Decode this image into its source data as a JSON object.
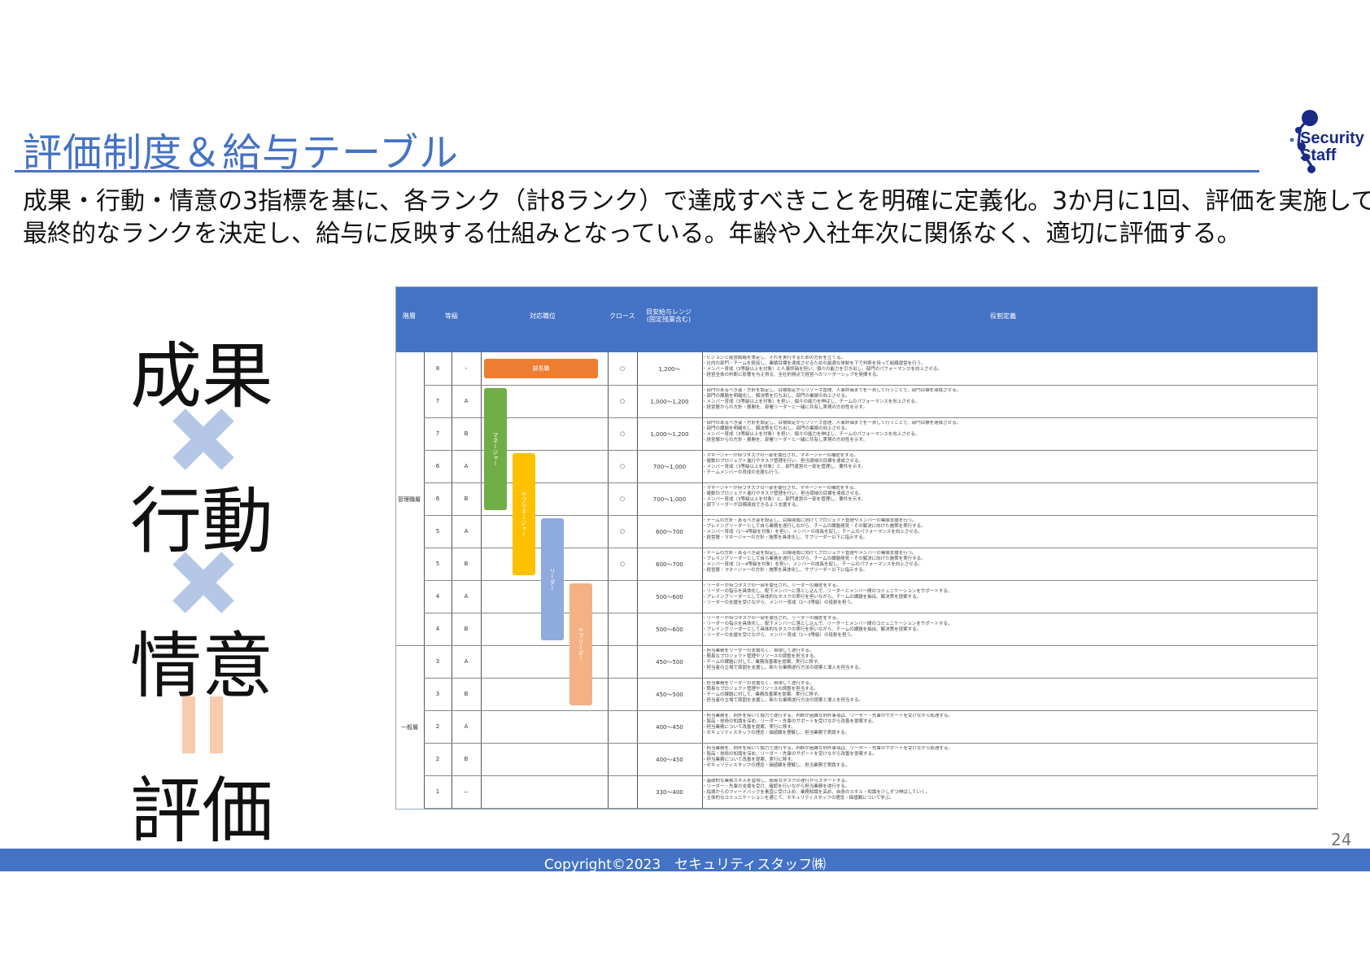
{
  "slide": {
    "title": "評価制度＆給与テーブル",
    "subtitle_line1": "成果・行動・情意の3指標を基に、各ランク（計8ランク）で達成すべきことを明確に定義化。3か月に1回、評価を実施して",
    "subtitle_line2": "最終的なランクを決定し、給与に反映する仕組みとなっている。年齢や入社年次に関係なく、適切に評価する。",
    "page_number": "24",
    "copyright": "Copyright©2023　セキュリティスタッフ㈱"
  },
  "logo": {
    "line1": "Security",
    "line2": "Staff",
    "color": "#1a2a86"
  },
  "formula": {
    "term1": "成果",
    "term2": "行動",
    "term3": "情意",
    "result": "評価",
    "times_color": "#b4c7e7",
    "equals_color": "#f8cbad"
  },
  "table": {
    "headers": {
      "tier": "階層",
      "grade": "等級",
      "role": "対応職位",
      "cross": "クロース",
      "salary": "目安給与レンジ\n(固定残業含む)",
      "definition": "役割定義"
    },
    "groups": {
      "management": "管理職層",
      "general": "一般層"
    },
    "rows": [
      {
        "grade": "8",
        "sub": "-",
        "cross": "○",
        "salary": "1,200～"
      },
      {
        "grade": "7",
        "sub": "A",
        "cross": "○",
        "salary": "1,000～1,200"
      },
      {
        "grade": "7",
        "sub": "B",
        "cross": "○",
        "salary": "1,000～1,200"
      },
      {
        "grade": "6",
        "sub": "A",
        "cross": "○",
        "salary": "700～1,000"
      },
      {
        "grade": "6",
        "sub": "B",
        "cross": "○",
        "salary": "700～1,000"
      },
      {
        "grade": "5",
        "sub": "A",
        "cross": "○",
        "salary": "600～700"
      },
      {
        "grade": "5",
        "sub": "B",
        "cross": "○",
        "salary": "600～700"
      },
      {
        "grade": "4",
        "sub": "A",
        "cross": "",
        "salary": "500～600"
      },
      {
        "grade": "4",
        "sub": "B",
        "cross": "",
        "salary": "500～600"
      },
      {
        "grade": "3",
        "sub": "A",
        "cross": "",
        "salary": "450～500"
      },
      {
        "grade": "3",
        "sub": "B",
        "cross": "",
        "salary": "450～500"
      },
      {
        "grade": "2",
        "sub": "A",
        "cross": "",
        "salary": "400～450"
      },
      {
        "grade": "2",
        "sub": "B",
        "cross": "",
        "salary": "400～450"
      },
      {
        "grade": "1",
        "sub": "－",
        "cross": "",
        "salary": "330～400"
      }
    ],
    "role_bars": {
      "executive": "部長職",
      "manager": "マネージャー",
      "submanager": "サブマネージャー",
      "leader": "リーダー",
      "subleader": "サブリーダー",
      "colors": {
        "executive": "#ed7d31",
        "manager": "#70ad47",
        "submanager": "#ffc000",
        "leader": "#8faadc",
        "subleader": "#f4b183",
        "header": "#4472c4"
      }
    },
    "descriptions": [
      [
        "・ビジョンと経営戦略を策定し、それを実行するための方針を立てる。",
        "・社内の部門・チームを統括し、業績目標を達成させるための最適な体制を下で判断を持って組織運営を行う。",
        "・メンバー育成（3等級以上を対象）と人事評価を担い、個々の能力を引き出し、部門のパフォーマンスを向上させる。",
        "・経営全体の判断に影響を与え得る、全社的視点で経営へのリーダーシップを発揮する。"
      ],
      [
        "・部門のあるべき姿・方針を設定し、目標設定からリソース管理、人事評価までを一貫して行うことで、部門目標を達成させる。",
        "・部門の課題を明確化し、解決策を打ち出し、部門の業績の向上させる。",
        "・メンバー育成（3等級以上を対象）を担い、個々の能力を伸ばし、チームのパフォーマンスを向上させる。",
        "・経営層からの方針・展開を、部署リーダーと一緒に共有し実現の方向性を示す。"
      ],
      [
        "・部門のあるべき姿・方針を設定し、目標設定からリソース管理、人事評価までを一貫して行うことで、部門目標を達成させる。",
        "・部門の課題を明確化し、解決策を打ち出し、部門の業績の向上させる。",
        "・メンバー育成（3等級以上を対象）を担い、個々の能力を伸ばし、チームのパフォーマンスを向上させる。",
        "・経営層からの方針・展開を、部署リーダーと一緒に共有し実現の方向性を示す。"
      ],
      [
        "・マネージャーが持つタスクの一部を委任され、マネージャーの補佐をする。",
        "・複数のプロジェクト進行やタスク管理を行い、担当領域の目標を達成させる。",
        "・メンバー育成（3等級以上を対象）と、部門運営の一部を管理し、要件を示す。",
        "・チームメンバーの育成の支援も行う。"
      ],
      [
        "・マネージャーが持つタスクの一部を委任され、マネージャーの補佐をする。",
        "・複数のプロジェクト進行やタスク管理を行い、担当領域の目標を達成させる。",
        "・メンバー育成（3等級以上を対象）と、部門運営の一部を管理し、要件を示す。",
        "・部下リーダーが目標達成できるよう支援する。"
      ],
      [
        "・チームの方針・あるべき姿を設定し、目標達成に向けてプロジェクト管理やメンバーの業績支援を行う。",
        "・プレイングリーダーとして自ら業務を遂行しながら、チームの課題発見・その解決に向けた施策を実行する。",
        "・メンバー育成（1～4等級を対象）を担い、メンバーの成長を促し、チームのパフォーマンスを向上させる。",
        "・経営層・マネージャーの方針・施策を具体化し、サブリーダー以下に指示する。"
      ],
      [
        "・チームの方針・あるべき姿を設定し、目標達成に向けてプロジェクト管理やメンバーの業績支援を行う。",
        "・プレイングリーダーとして自ら業務を遂行しながら、チームの課題発見・その解決に向けた施策を実行する。",
        "・メンバー育成（1～4等級を対象）を担い、メンバーの成長を促し、チームのパフォーマンスを向上させる。",
        "・経営層・マネージャーの方針・施策を具体化し、サブリーダー以下に指示する。"
      ],
      [
        "・リーダーが持つタスクの一部を委任され、リーダーの補佐をする。",
        "・リーダーの指示を具体化し、配下メンバーに落とし込んで、リーダーとメンバー間のコミュニケーションをサポートする。",
        "・プレイングリーダーとして具体的なタスクの実行を担いながら、チームの課題を抽出、解決策を提案する。",
        "・リーダーの支援を受けながら、メンバー育成（1～3等級）の役割を担う。"
      ],
      [
        "・リーダーが持つタスクの一部を委任され、リーダーの補佐をする。",
        "・リーダーの指示を具体化し、配下メンバーに落とし込んで、リーダーとメンバー間のコミュニケーションをサポートする。",
        "・プレイングリーダーとして具体的なタスクの実行を担いながら、チームの課題を抽出、解決策を提案する。",
        "・リーダーの支援を受けながら、メンバー育成（1～3等級）の役割を担う。"
      ],
      [
        "・担当業務をリーダーの支援なく、自律して遂行する。",
        "・簡易なプロジェクト管理やリソースの調整を担当する。",
        "・チームの課題に対して、業務改善案を提案、実行に移す。",
        "・担当者の立場で周囲を支援し、新たな業務遂行方法の提案と導入を担当する。"
      ],
      [
        "・担当業務をリーダーの支援なく、自律して遂行する。",
        "・簡易なプロジェクト管理やリソースの調整を担当する。",
        "・チームの課題に対して、業務改善案を提案、実行に移す。",
        "・担当者の立場で周囲を支援し、新たな業務遂行方法の提案と導入を担当する。"
      ],
      [
        "・担当業務を、例外を除いて独力で遂行する。判断が困難な例外事項は、リーダー・先輩のサポートを受けながら処理する。",
        "・製品・技術の知識を深め、リーダー・先輩のサポートを受けながら改善を提案する。",
        "・担当業務について改善を提案、実行に移す。",
        "・セキュリティスタッフの理念・価値観を理解し、担当業務で実践する。"
      ],
      [
        "・担当業務を、例外を除いて独力で遂行する。判断が困難な例外事項は、リーダー・先輩のサポートを受けながら処理する。",
        "・製品・技術の知識を深め、リーダー・先輩のサポートを受けながら改善を提案する。",
        "・担当業務について改善を提案、実行に移す。",
        "・セキュリティスタッフの理念・価値観を理解し、担当業務で実践する。"
      ],
      [
        "・基礎的な業務スキルを習得し、簡易なタスクの遂行からスタートする。",
        "・リーダー・先輩の支援を受け、確認を行いながら担当業務を遂行する。",
        "・指導からのフィードバックを素直に受け止め、業務知識を高め、自身のスキル・知識を少しずつ伸ばしていく。",
        "・主体的なコミュニケーションを通じて、セキュリティスタッフの理念・価値観について学ぶ。"
      ]
    ]
  }
}
